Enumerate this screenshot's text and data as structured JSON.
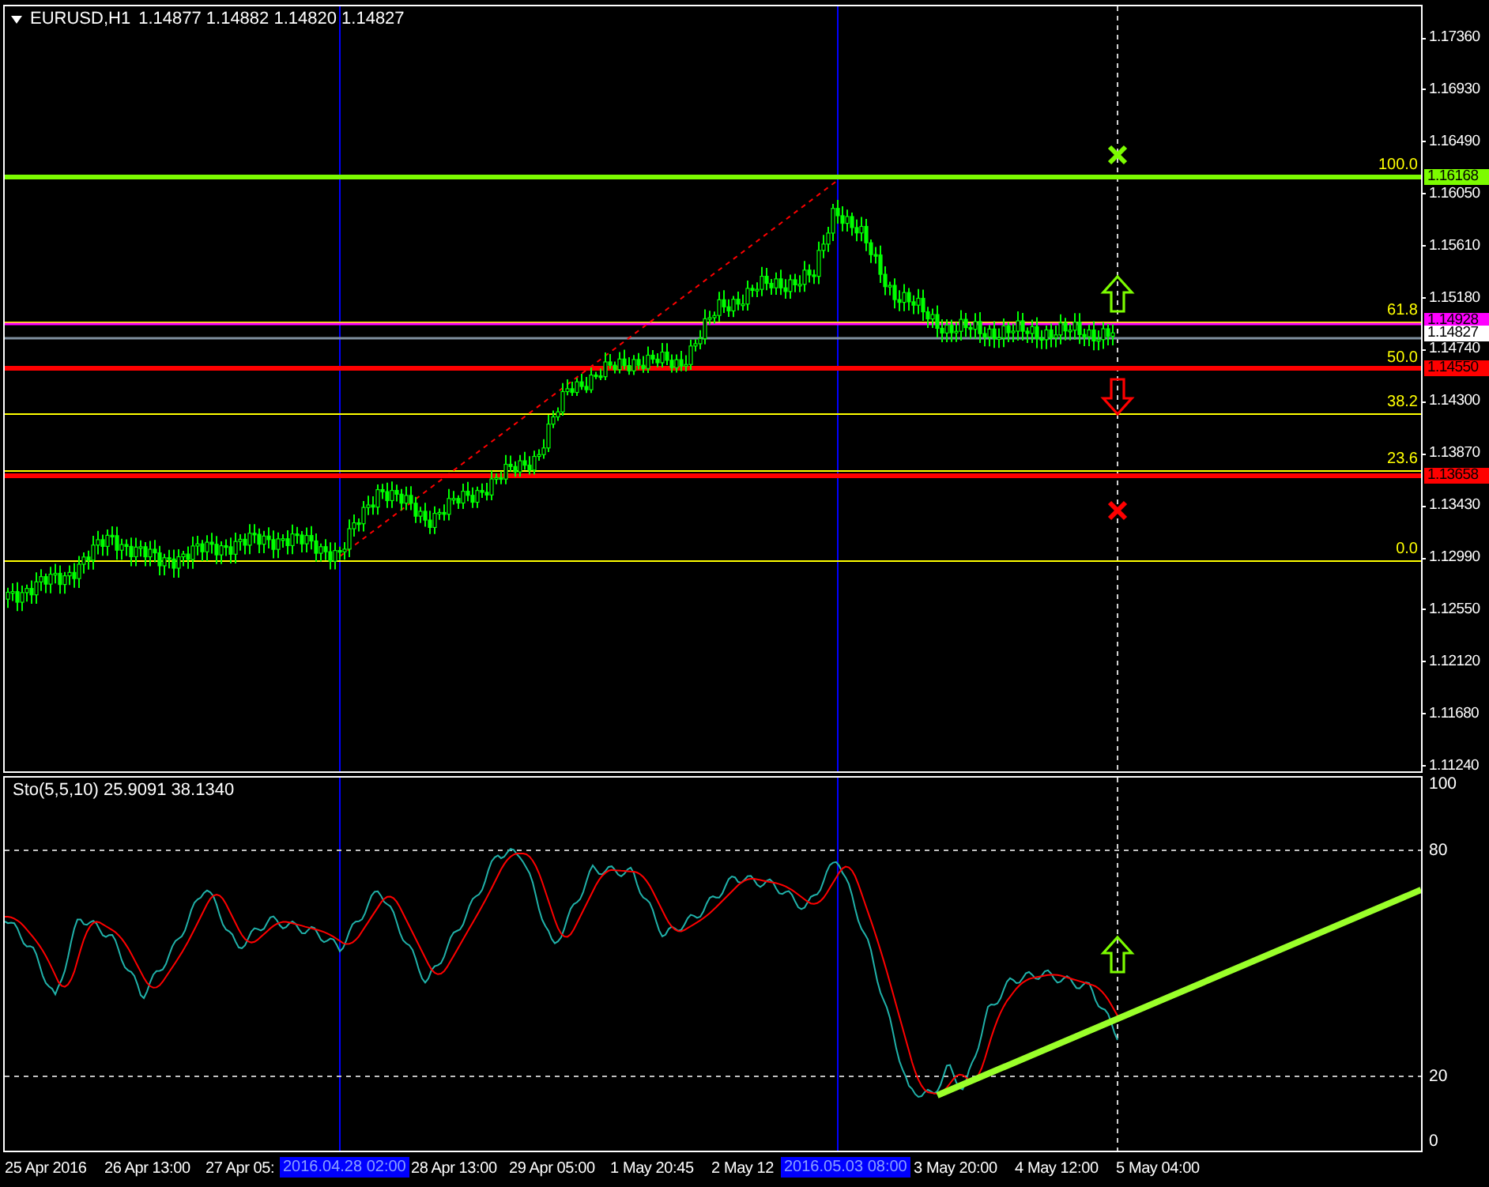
{
  "header": {
    "symbol": "EURUSD,H1",
    "prices": [
      "1.14877",
      "1.14882",
      "1.14820",
      "1.14827"
    ]
  },
  "price_axis": {
    "ticks": [
      "1.17360",
      "1.16930",
      "1.16490",
      "1.16050",
      "1.15610",
      "1.15180",
      "1.14740",
      "1.14300",
      "1.13870",
      "1.13430",
      "1.12990",
      "1.12550",
      "1.12120",
      "1.11680",
      "1.11240"
    ]
  },
  "price_markers": [
    {
      "text": "1.16168",
      "color": "#7cfc00"
    },
    {
      "text": "1.14928",
      "color": "#ff00ff"
    },
    {
      "text": "1.14827",
      "color": "#ffffff"
    },
    {
      "text": "1.14550",
      "color": "#ff0000"
    },
    {
      "text": "1.13658",
      "color": "#ff0000"
    }
  ],
  "fib_levels": [
    "100.0",
    "61.8",
    "50.0",
    "38.2",
    "23.6",
    "0.0"
  ],
  "indicator": {
    "label": "Sto(5,5,10) 25.9091 38.1340",
    "ticks": [
      "100",
      "80",
      "20",
      "0"
    ]
  },
  "time_axis": [
    {
      "text": "25 Apr 2016",
      "kind": "tick"
    },
    {
      "text": "26 Apr 13:00",
      "kind": "tick"
    },
    {
      "text": "27 Apr 05:",
      "kind": "tick"
    },
    {
      "text": "2016.04.28 02:00",
      "kind": "marker"
    },
    {
      "text": "28 Apr 13:00",
      "kind": "tick"
    },
    {
      "text": "29 Apr 05:00",
      "kind": "tick"
    },
    {
      "text": "1 May 20:45",
      "kind": "tick"
    },
    {
      "text": "2 May 12",
      "kind": "tick"
    },
    {
      "text": "2016.05.03 08:00",
      "kind": "marker"
    },
    {
      "text": "3 May 20:00",
      "kind": "tick"
    },
    {
      "text": "4 May 12:00",
      "kind": "tick"
    },
    {
      "text": "5 May 04:00",
      "kind": "tick"
    }
  ]
}
